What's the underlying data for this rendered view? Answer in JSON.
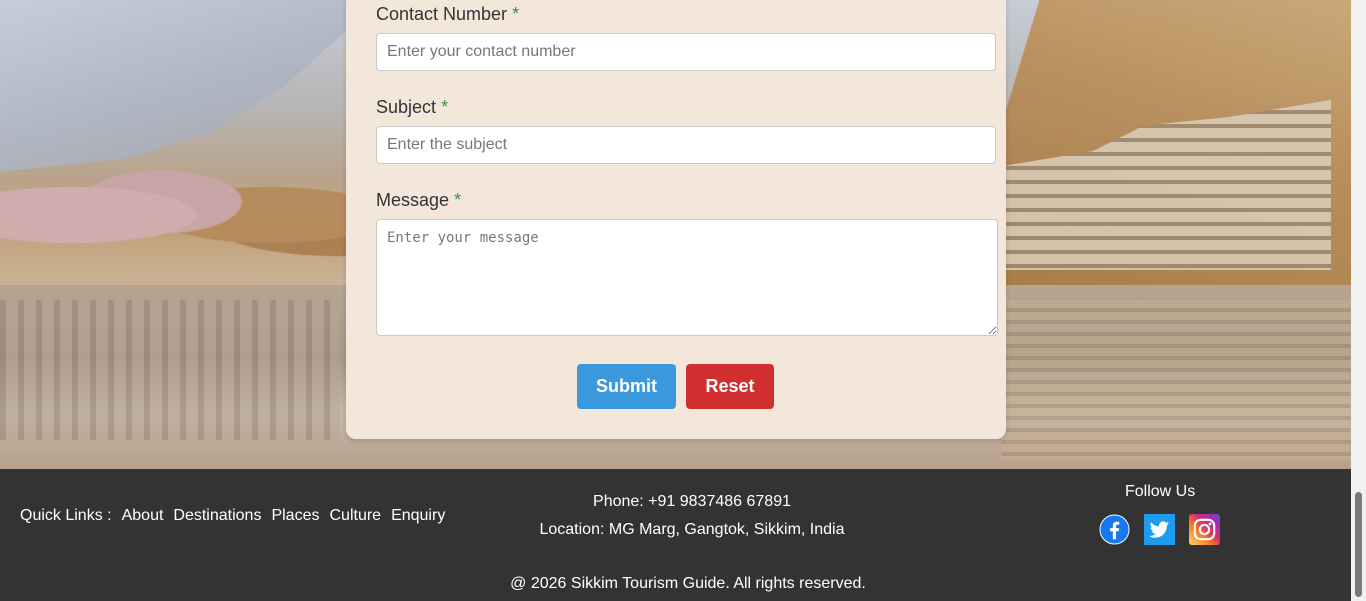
{
  "form": {
    "contact_label": "Contact Number",
    "contact_placeholder": "Enter your contact number",
    "subject_label": "Subject",
    "subject_placeholder": "Enter the subject",
    "message_label": "Message",
    "message_placeholder": "Enter your message",
    "required_mark": "*",
    "submit_label": "Submit",
    "reset_label": "Reset"
  },
  "footer": {
    "quick_links_label": "Quick Links :",
    "links": [
      "About",
      "Destinations",
      "Places",
      "Culture",
      "Enquiry"
    ],
    "phone": "Phone: +91 9837486 67891",
    "location": "Location: MG Marg, Gangtok, Sikkim, India",
    "follow_label": "Follow Us",
    "social_icons": [
      "facebook-icon",
      "twitter-icon",
      "instagram-icon"
    ],
    "copyright": "@ 2026 Sikkim Tourism Guide. All rights reserved."
  },
  "colors": {
    "card_bg": "#f3e7dc",
    "submit": "#3a99dc",
    "reset": "#d12f2f",
    "footer_bg": "#333333",
    "required": "#2e9b3e"
  }
}
